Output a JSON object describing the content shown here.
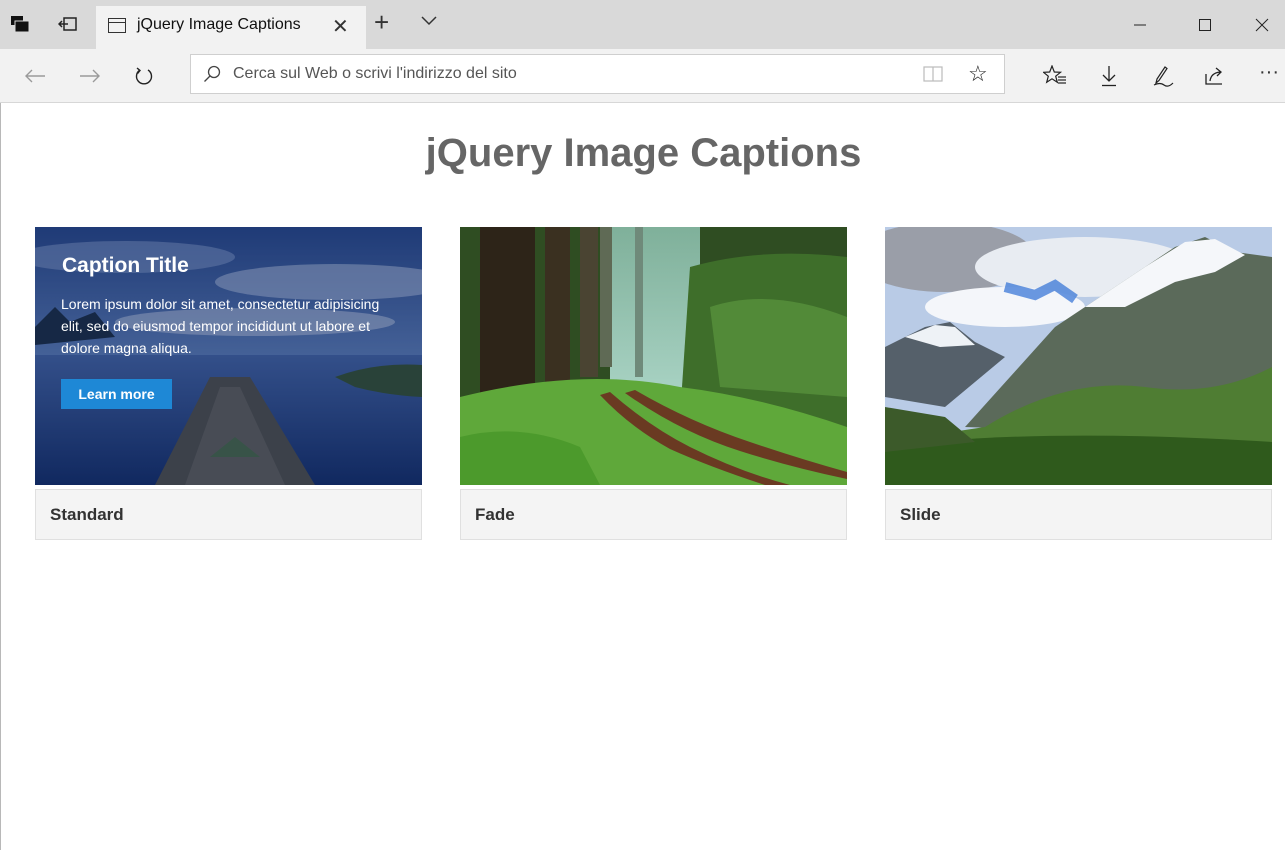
{
  "browser": {
    "tab_title": "jQuery Image Captions",
    "address_placeholder": "Cerca sul Web o scrivi l'indirizzo del sito"
  },
  "page": {
    "heading": "jQuery Image Captions",
    "cards": [
      {
        "label": "Standard",
        "caption": {
          "title": "Caption Title",
          "text": "Lorem ipsum dolor sit amet, consectetur adipisicing elit, sed do eiusmod tempor incididunt ut labore et dolore magna aliqua.",
          "button": "Learn more"
        }
      },
      {
        "label": "Fade"
      },
      {
        "label": "Slide"
      }
    ]
  },
  "colors": {
    "accent": "#1e88d6",
    "heading": "#666666",
    "titlebar": "#d9d9d9"
  }
}
